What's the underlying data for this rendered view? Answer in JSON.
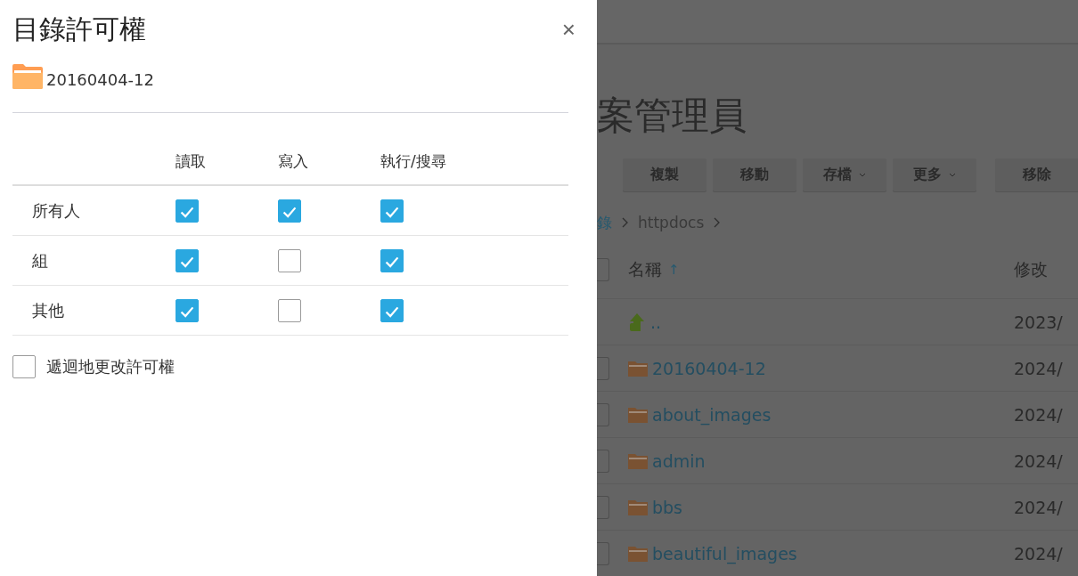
{
  "dialog": {
    "title": "目錄許可權",
    "folder": "20160404-12",
    "close": "×",
    "columns": [
      "讀取",
      "寫入",
      "執行/搜尋"
    ],
    "rows": [
      {
        "label": "所有人",
        "read": true,
        "write": true,
        "execute": true
      },
      {
        "label": "組",
        "read": true,
        "write": false,
        "execute": true
      },
      {
        "label": "其他",
        "read": true,
        "write": false,
        "execute": true
      }
    ],
    "recursive": {
      "label": "遞迴地更改許可權",
      "checked": false
    }
  },
  "background": {
    "title": "案管理員",
    "toolbar": [
      {
        "label": "複製",
        "dropdown": false
      },
      {
        "label": "移動",
        "dropdown": false
      },
      {
        "label": "存檔",
        "dropdown": true
      },
      {
        "label": "更多",
        "dropdown": true
      },
      {
        "label": "移除",
        "dropdown": false
      }
    ],
    "breadcrumb": [
      "錄",
      "httpdocs"
    ],
    "columns": [
      "名稱",
      "修改"
    ],
    "sort_mark": "↑",
    "select_all_checked": false,
    "rows": [
      {
        "kind": "parent",
        "name": "..",
        "date": "2023/"
      },
      {
        "kind": "folder",
        "name": "20160404-12",
        "date": "2024/",
        "checked": false
      },
      {
        "kind": "folder",
        "name": "about_images",
        "date": "2024/",
        "checked": false
      },
      {
        "kind": "folder",
        "name": "admin",
        "date": "2024/",
        "checked": false
      },
      {
        "kind": "folder",
        "name": "bbs",
        "date": "2024/",
        "checked": false
      },
      {
        "kind": "folder",
        "name": "beautiful_images",
        "date": "2024/",
        "checked": false
      }
    ]
  }
}
